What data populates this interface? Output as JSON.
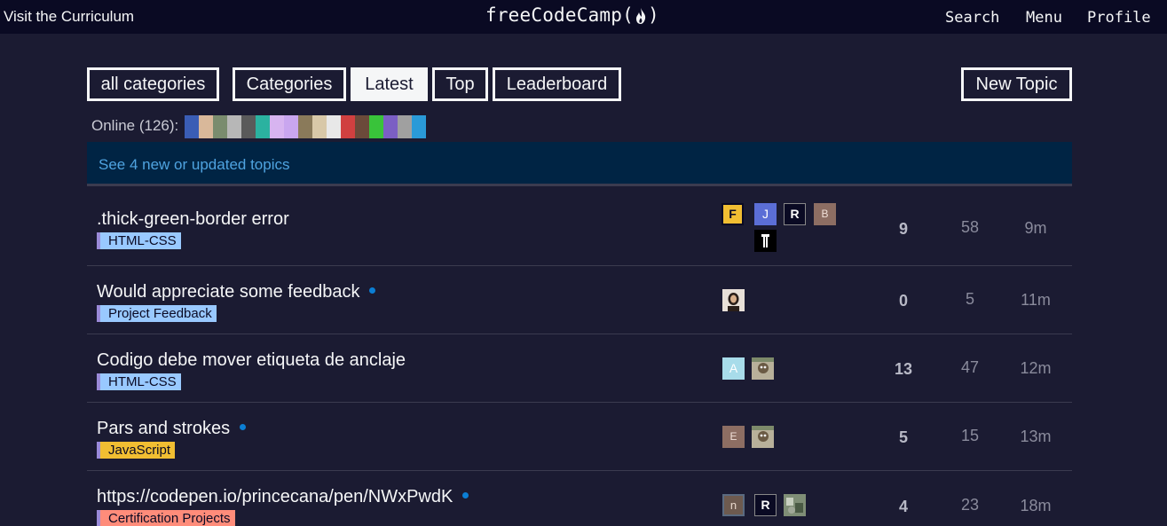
{
  "topbar": {
    "curriculum_link": "Visit the Curriculum",
    "logo_text_left": "freeCodeCamp(",
    "logo_text_right": ")",
    "search": "Search",
    "menu": "Menu",
    "profile": "Profile"
  },
  "nav": {
    "all_categories": "all categories",
    "categories": "Categories",
    "latest": "Latest",
    "top": "Top",
    "leaderboard": "Leaderboard",
    "new_topic": "New Topic"
  },
  "online": {
    "label": "Online (126):"
  },
  "banner": {
    "text": "See 4 new or updated topics"
  },
  "topics": [
    {
      "title": ".thick-green-border error",
      "tag": "HTML-CSS",
      "tag_color": "#99c9ff",
      "unread": false,
      "replies": "9",
      "views": "58",
      "activity": "9m"
    },
    {
      "title": "Would appreciate some feedback",
      "tag": "Project Feedback",
      "tag_color": "#99c9ff",
      "unread": true,
      "replies": "0",
      "views": "5",
      "activity": "11m"
    },
    {
      "title": "Codigo debe mover etiqueta de anclaje",
      "tag": "HTML-CSS",
      "tag_color": "#99c9ff",
      "unread": false,
      "replies": "13",
      "views": "47",
      "activity": "12m"
    },
    {
      "title": "Pars and strokes",
      "tag": "JavaScript",
      "tag_color": "#f1be32",
      "unread": true,
      "replies": "5",
      "views": "15",
      "activity": "13m"
    },
    {
      "title": "https://codepen.io/princecana/pen/NWxPwdK",
      "tag": "Certification Projects",
      "tag_color": "#ff8c7a",
      "unread": true,
      "replies": "4",
      "views": "23",
      "activity": "18m"
    }
  ],
  "posters": {
    "r0": [
      "F",
      "J",
      "R",
      "B",
      "fork"
    ],
    "r1": [
      "photo"
    ],
    "r2": [
      "A",
      "photo"
    ],
    "r3": [
      "E",
      "photo"
    ],
    "r4": [
      "n",
      "R",
      "photo"
    ]
  },
  "colors": {
    "background": "#1b1b32",
    "topbar": "#0a0a23",
    "banner": "#002444",
    "link": "#4fa3e0",
    "unread_dot": "#0b7ed4"
  }
}
